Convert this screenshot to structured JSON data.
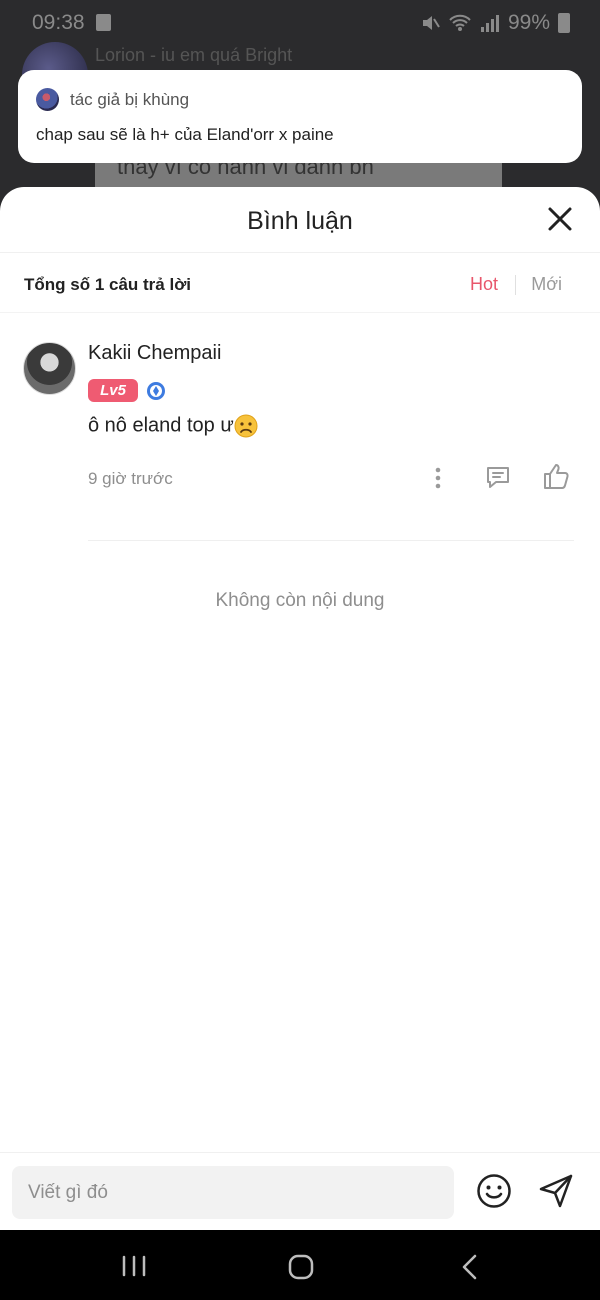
{
  "status_bar": {
    "time": "09:38",
    "battery": "99%"
  },
  "background": {
    "title": "Lorion - iu em quá Bright",
    "bubble_text": "thay vì có hành vi đánh bn"
  },
  "notification": {
    "author": "tác giả bị khùng",
    "message": "chap sau sẽ là h+ của Eland'orr x paine"
  },
  "sheet": {
    "title": "Bình luận",
    "summary": "Tổng số 1 câu trả lời",
    "sort": {
      "hot": "Hot",
      "new": "Mới"
    },
    "accent_color": "#e8566b"
  },
  "comments": [
    {
      "username": "Kakii Chempaii",
      "level": "Lv5",
      "text": "ô nô eland top ư",
      "time": "9 giờ trước"
    }
  ],
  "empty_text": "Không còn nội dung",
  "input": {
    "placeholder": "Viết gì đó"
  }
}
